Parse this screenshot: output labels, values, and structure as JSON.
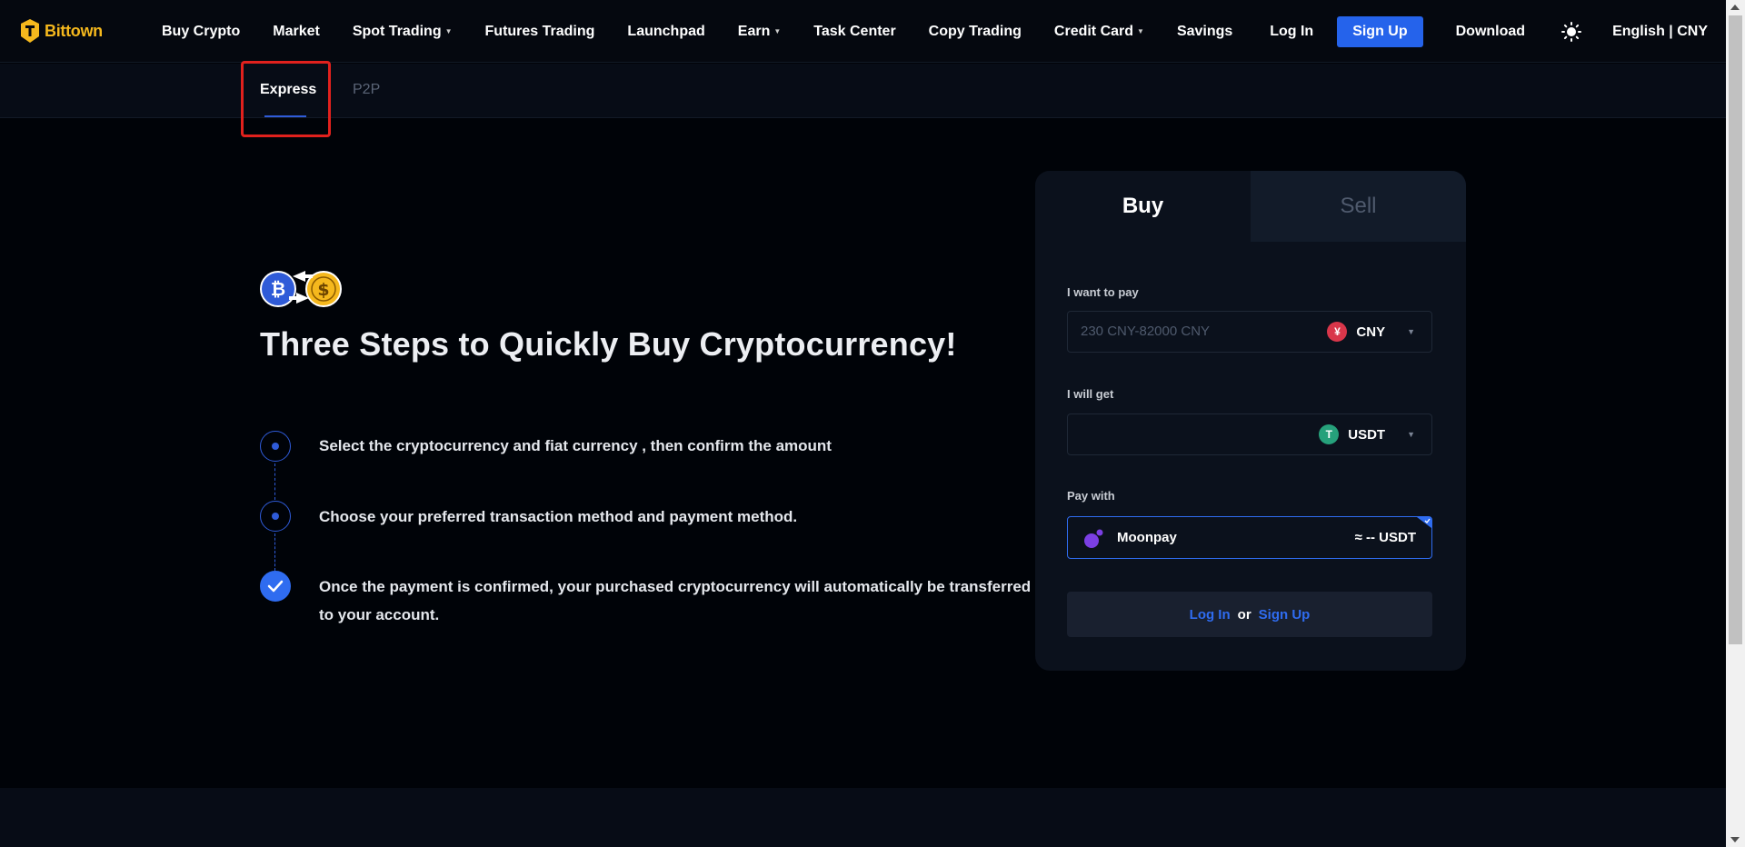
{
  "header": {
    "brand": "Bittown",
    "nav": [
      {
        "label": "Buy Crypto",
        "caret": false
      },
      {
        "label": "Market",
        "caret": false
      },
      {
        "label": "Spot Trading",
        "caret": true
      },
      {
        "label": "Futures Trading",
        "caret": false
      },
      {
        "label": "Launchpad",
        "caret": false
      },
      {
        "label": "Earn",
        "caret": true
      },
      {
        "label": "Task Center",
        "caret": false
      },
      {
        "label": "Copy Trading",
        "caret": false
      },
      {
        "label": "Credit Card",
        "caret": true
      },
      {
        "label": "Savings",
        "caret": false
      }
    ],
    "login": "Log In",
    "signup": "Sign Up",
    "download": "Download",
    "theme_icon": "sun-icon",
    "language": "English | CNY"
  },
  "subnav": {
    "tabs": [
      {
        "label": "Express",
        "active": true
      },
      {
        "label": "P2P",
        "active": false
      }
    ]
  },
  "hero": {
    "title": "Three Steps to Quickly Buy Cryptocurrency!",
    "steps": [
      {
        "lines": [
          "Select the cryptocurrency and fiat currency , then confirm the amount"
        ],
        "status": "current"
      },
      {
        "lines": [
          "Choose your preferred transaction method and payment method."
        ],
        "status": "current"
      },
      {
        "lines": [
          "Once the payment is confirmed, your purchased cryptocurrency will automatically be transferred",
          "to your account."
        ],
        "status": "done"
      }
    ]
  },
  "trade_card": {
    "tabs": {
      "buy": "Buy",
      "sell": "Sell"
    },
    "pay": {
      "label": "I want to pay",
      "placeholder": "230 CNY-82000 CNY",
      "currency": "CNY",
      "currency_symbol": "¥",
      "currency_color": "#d9364a"
    },
    "get": {
      "label": "I will get",
      "placeholder": "",
      "currency": "USDT",
      "currency_symbol": "T",
      "currency_color": "#26a17b"
    },
    "pay_with": {
      "label": "Pay with",
      "provider": "Moonpay",
      "estimate": "≈ -- USDT"
    },
    "auth": {
      "login": "Log In",
      "or": "or",
      "signup": "Sign Up"
    }
  },
  "colors": {
    "accent": "#2f6cf0",
    "brand": "#f5b81d",
    "highlight": "#e1211d",
    "background": "#000308"
  }
}
